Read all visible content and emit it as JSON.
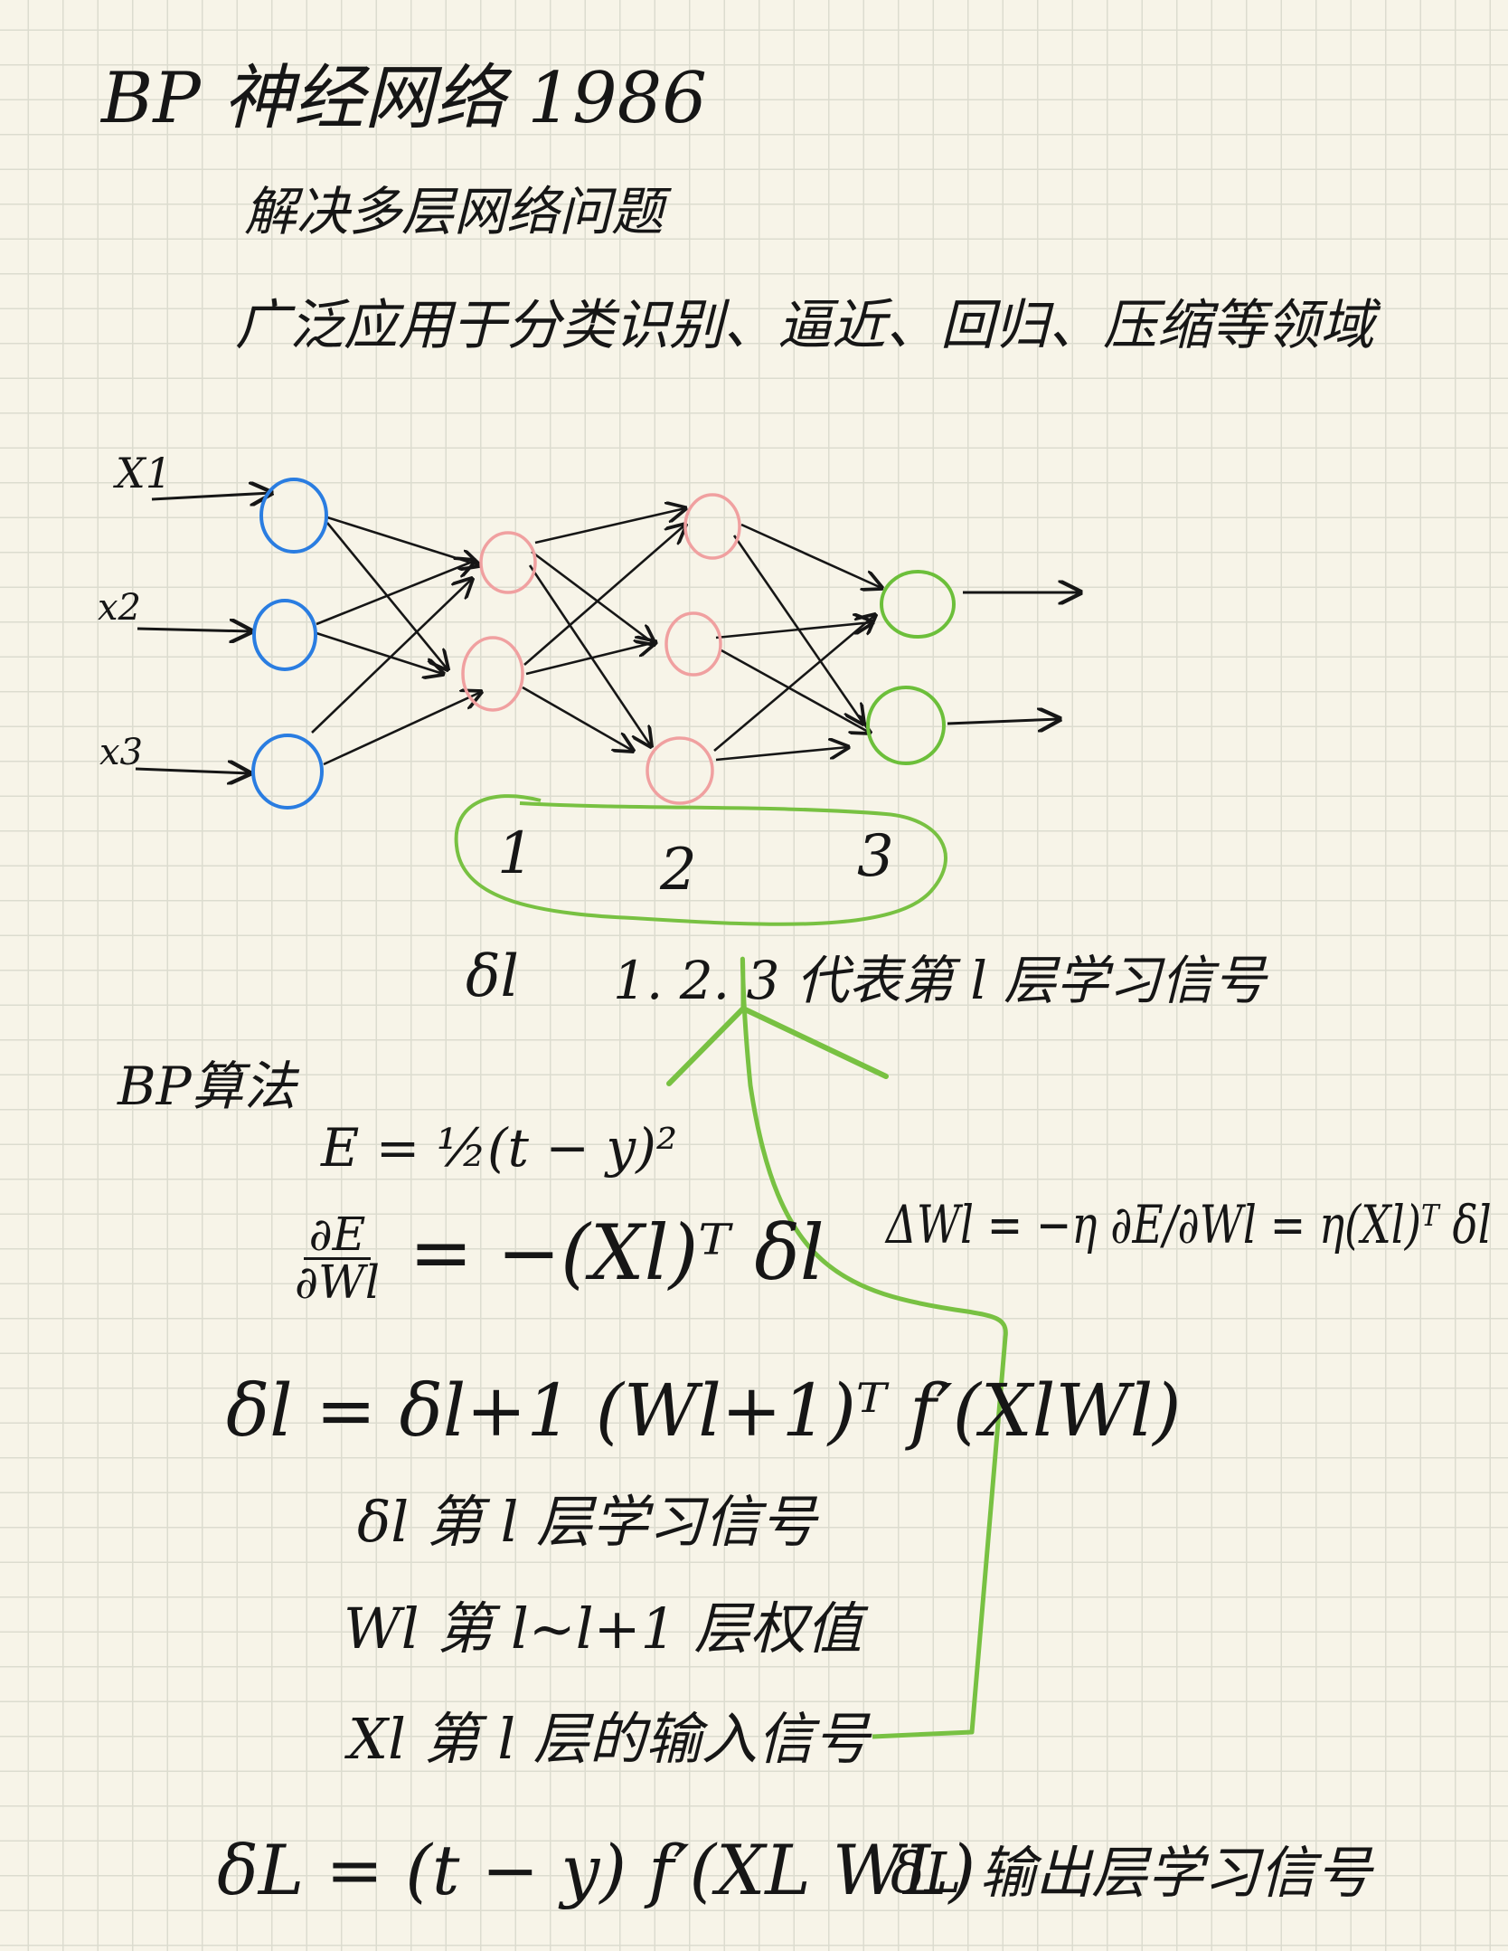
{
  "header": {
    "title": "BP 神经网络 1986",
    "subtitle": "解决多层网络问题",
    "applications": "广泛应用于分类识别、逼近、回归、压缩等领域"
  },
  "network": {
    "inputs": [
      "X1",
      "x2",
      "x3"
    ],
    "layer_numbers": [
      "1",
      "2",
      "3"
    ],
    "colors": {
      "input": "#2a7de1",
      "hidden": "#f0a0a0",
      "output": "#6cbf3a",
      "annotation": "#78c142",
      "ink": "#161616"
    }
  },
  "delta_note": {
    "symbol": "δl",
    "text": "1. 2. 3 代表第 l 层学习信号"
  },
  "algorithm": {
    "title": "BP算法",
    "error_formula": "E = ½(t − y)²",
    "gradient_lhs_num": "∂E",
    "gradient_lhs_den": "∂Wl",
    "gradient_rhs": "= −(Xl)ᵀ δl",
    "weight_update": "ΔWl = −η ∂E/∂Wl = η(Xl)ᵀ δl",
    "delta_recursion": "δl = δl+1 (Wl+1)ᵀ f′(XlWl)",
    "defs": [
      "δl 第 l 层学习信号",
      "Wl 第 l~l+1 层权值",
      "Xl 第 l 层的输入信号"
    ],
    "output_delta": "δL = (t − y) f′(XL WL)",
    "output_delta_desc": "δL 输出层学习信号"
  }
}
